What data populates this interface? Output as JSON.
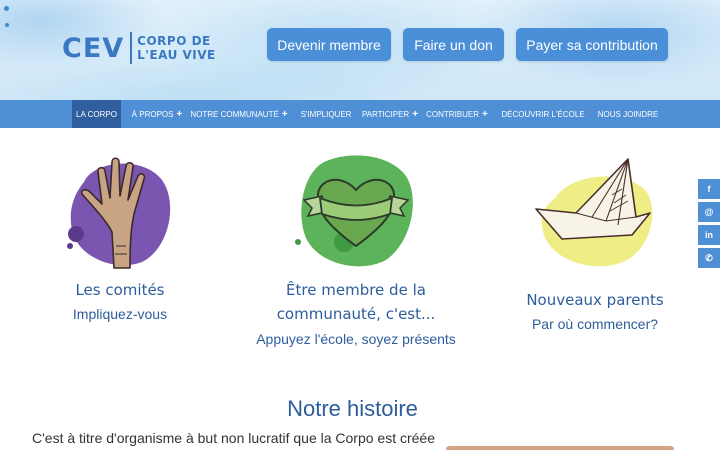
{
  "header": {
    "logo": {
      "abbr": "CEV",
      "line1": "CORPO DE",
      "line2": "L'EAU VIVE"
    },
    "buttons": [
      "Devenir membre",
      "Faire un don",
      "Payer sa contribution"
    ]
  },
  "nav": {
    "items": [
      {
        "label": "LA CORPO",
        "plus": ""
      },
      {
        "label": "À PROPOS",
        "plus": "+"
      },
      {
        "label": "NOTRE COMMUNAUTÉ",
        "plus": "+"
      },
      {
        "label": "S'IMPLIQUER",
        "plus": ""
      },
      {
        "label": "PARTICIPER",
        "plus": "+"
      },
      {
        "label": "CONTRIBUER",
        "plus": "+"
      },
      {
        "label": "DÉCOUVRIR L'ÉCOLE",
        "plus": ""
      },
      {
        "label": "NOUS JOINDRE",
        "plus": ""
      }
    ]
  },
  "social": {
    "facebook": "f",
    "email": "@",
    "linkedin": "in",
    "whatsapp": "✆"
  },
  "features": [
    {
      "title": "Les comités",
      "subtitle": "Impliquez-vous",
      "icon": "hand-icon",
      "blob_color": "#7b56b0"
    },
    {
      "title_line1": "Être membre de la",
      "title_line2": "communauté, c'est...",
      "subtitle": "Appuyez l'école, soyez présents",
      "icon": "heart-banner-icon",
      "blob_color": "#5cb35a"
    },
    {
      "title": "Nouveaux parents",
      "subtitle": "Par où commencer?",
      "icon": "paper-boat-icon",
      "blob_color": "#eeed86"
    }
  ],
  "history": {
    "title": "Notre histoire",
    "text": "C'est à titre d'organisme à but non lucratif que la Corpo est créée"
  },
  "colors": {
    "accent": "#4f8fd6",
    "nav_active": "#2f5f9e",
    "title": "#2d5d9c"
  }
}
